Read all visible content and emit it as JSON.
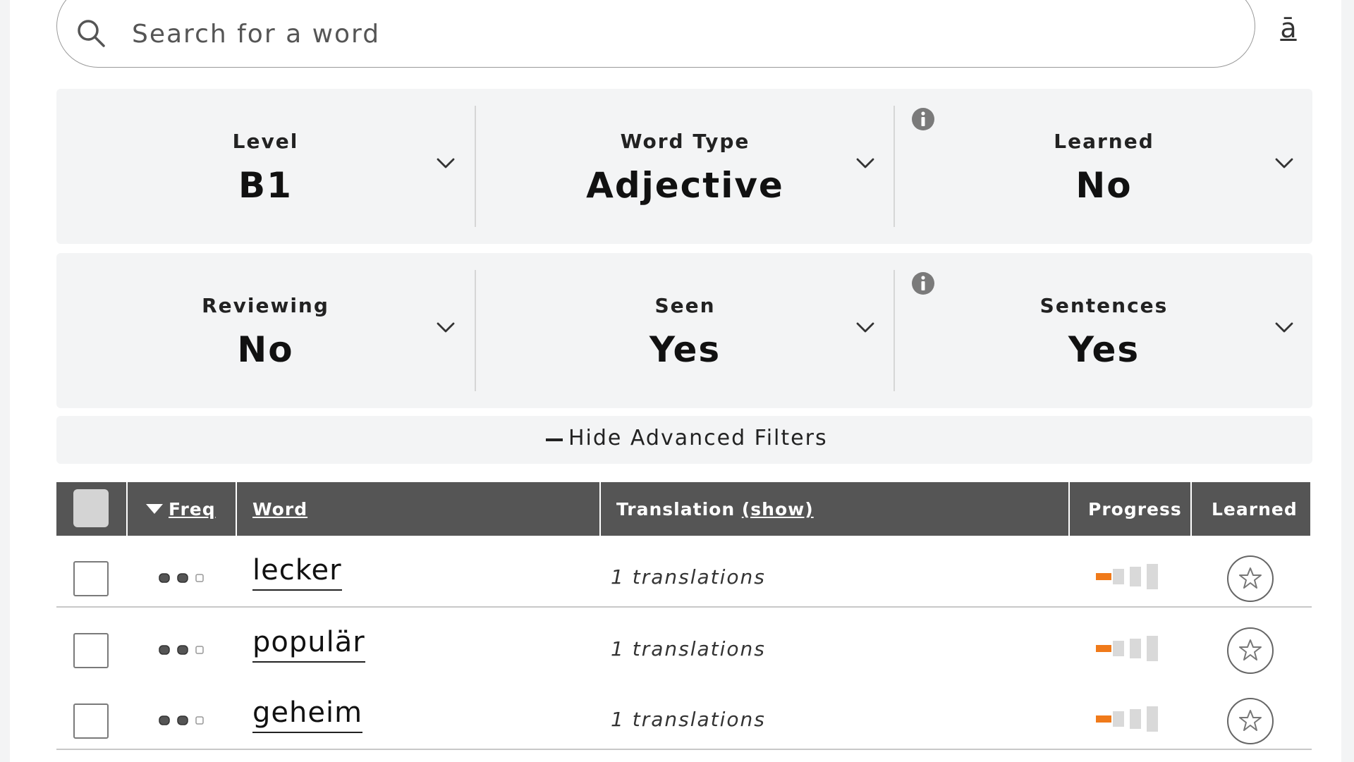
{
  "search": {
    "placeholder": "Search for a word",
    "special_char_label": "ā"
  },
  "filters": {
    "row1": [
      {
        "label": "Level",
        "value": "B1"
      },
      {
        "label": "Word Type",
        "value": "Adjective"
      },
      {
        "label": "Learned",
        "value": "No"
      }
    ],
    "row2": [
      {
        "label": "Reviewing",
        "value": "No"
      },
      {
        "label": "Seen",
        "value": "Yes"
      },
      {
        "label": "Sentences",
        "value": "Yes"
      }
    ]
  },
  "advanced_toggle": {
    "label": "Hide Advanced Filters"
  },
  "table": {
    "headers": {
      "freq": "Freq",
      "word": "Word",
      "translation": "Translation",
      "translation_toggle": "(show)",
      "progress": "Progress",
      "learned": "Learned"
    },
    "rows": [
      {
        "word": "lecker",
        "translations": "1 translations",
        "freq_level": 2,
        "progress_level": 1
      },
      {
        "word": "populär",
        "translations": "1 translations",
        "freq_level": 2,
        "progress_level": 1
      },
      {
        "word": "geheim",
        "translations": "1 translations",
        "freq_level": 2,
        "progress_level": 1
      }
    ]
  },
  "colors": {
    "header_bg": "#555555",
    "panel_bg": "#f3f4f5",
    "progress_accent": "#f07a1a",
    "progress_inactive": "#d9d9d9"
  },
  "icons": {
    "search": "search-icon",
    "info": "info-icon",
    "chevron": "chevron-down-icon",
    "star": "star-icon"
  }
}
